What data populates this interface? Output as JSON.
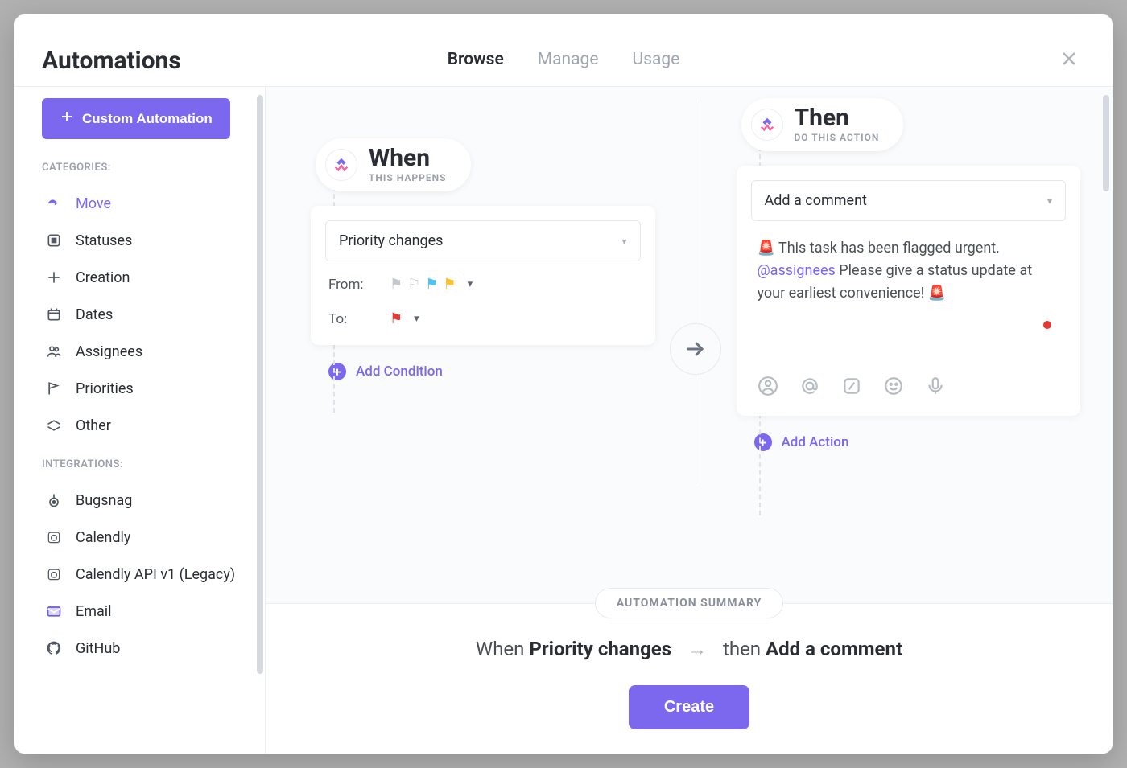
{
  "header": {
    "title": "Automations",
    "tabs": {
      "browse": "Browse",
      "manage": "Manage",
      "usage": "Usage"
    }
  },
  "sidebar": {
    "custom_button": "Custom Automation",
    "categories_label": "CATEGORIES:",
    "integrations_label": "INTEGRATIONS:",
    "categories": [
      {
        "label": "Move"
      },
      {
        "label": "Statuses"
      },
      {
        "label": "Creation"
      },
      {
        "label": "Dates"
      },
      {
        "label": "Assignees"
      },
      {
        "label": "Priorities"
      },
      {
        "label": "Other"
      }
    ],
    "integrations": [
      {
        "label": "Bugsnag"
      },
      {
        "label": "Calendly"
      },
      {
        "label": "Calendly API v1 (Legacy)"
      },
      {
        "label": "Email"
      },
      {
        "label": "GitHub"
      }
    ]
  },
  "builder": {
    "when": {
      "title": "When",
      "subtitle": "THIS HAPPENS",
      "trigger_select": "Priority changes",
      "from_label": "From:",
      "to_label": "To:",
      "add_condition": "Add Condition"
    },
    "then": {
      "title": "Then",
      "subtitle": "DO THIS ACTION",
      "action_select": "Add a comment",
      "comment_pre": "🚨 This task has been flagged urgent. ",
      "comment_mention": "@assignees",
      "comment_post": " Please give a status update at your earliest convenience! 🚨",
      "add_action": "Add Action"
    }
  },
  "summary": {
    "pill": "AUTOMATION SUMMARY",
    "when_prefix": "When ",
    "when_bold": "Priority changes",
    "then_prefix": "then ",
    "then_bold": "Add a comment",
    "create": "Create"
  }
}
